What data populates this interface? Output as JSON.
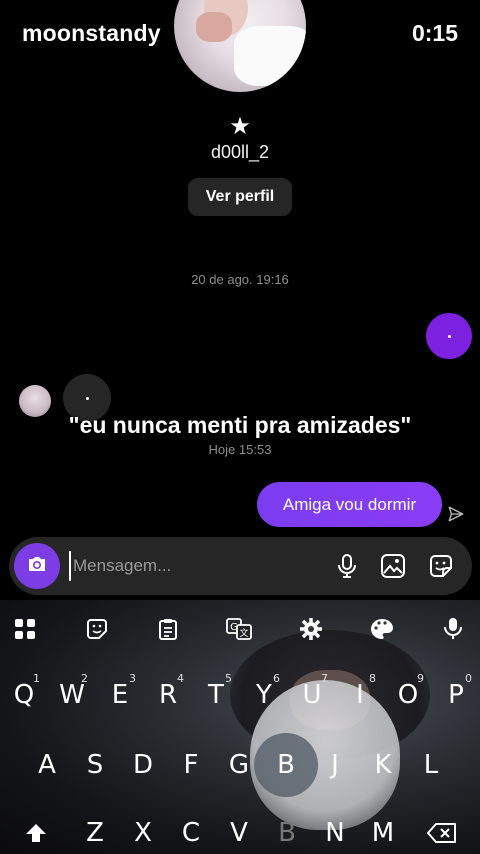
{
  "overlay": {
    "channel": "moonstandy",
    "timer": "0:15"
  },
  "profile": {
    "star": "★",
    "username": "d00ll_2",
    "view_profile": "Ver perfil"
  },
  "thread": {
    "date_label": "20 de ago. 19:16",
    "sent_dot": ".",
    "recv_dot": ".",
    "caption": "\"eu nunca menti pra amizades\"",
    "caption_time": "Hoje 15:53",
    "sent_message": "Amiga vou dormir"
  },
  "composer": {
    "placeholder": "Mensagem..."
  },
  "keyboard": {
    "row1": [
      {
        "key": "Q",
        "num": "1"
      },
      {
        "key": "W",
        "num": "2"
      },
      {
        "key": "E",
        "num": "3"
      },
      {
        "key": "R",
        "num": "4"
      },
      {
        "key": "T",
        "num": "5"
      },
      {
        "key": "Y",
        "num": "6"
      },
      {
        "key": "U",
        "num": "7"
      },
      {
        "key": "I",
        "num": "8"
      },
      {
        "key": "O",
        "num": "9"
      },
      {
        "key": "P",
        "num": "0"
      }
    ],
    "row2": [
      "A",
      "S",
      "D",
      "F",
      "G",
      "B",
      "J",
      "K",
      "L"
    ],
    "row3": [
      "Z",
      "X",
      "C",
      "V",
      "B",
      "N",
      "M"
    ]
  },
  "icons": {
    "camera": "camera-icon",
    "mic": "microphone-icon",
    "gallery": "gallery-icon",
    "sticker": "sticker-icon",
    "send_status": "send-icon",
    "shift": "shift-icon",
    "backspace": "backspace-icon"
  },
  "colors": {
    "accent": "#7c3de4",
    "bubble": "#8a3cf5",
    "surface": "#262626",
    "muted": "#8e8e8e"
  }
}
